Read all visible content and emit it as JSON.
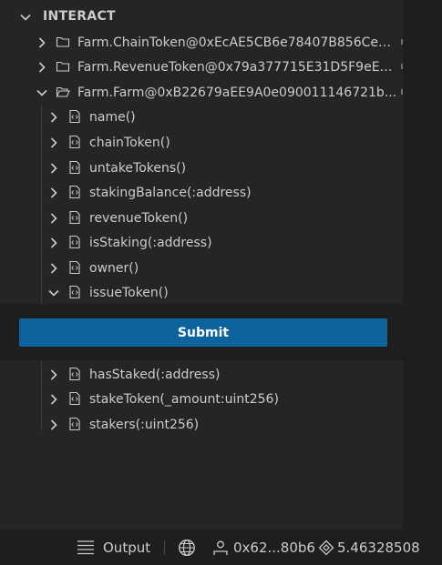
{
  "section": {
    "title": "INTERACT"
  },
  "contracts": [
    {
      "label": "Farm.ChainToken@0xEcAE5CB6e78407B856Ce2...",
      "expanded": false
    },
    {
      "label": "Farm.RevenueToken@0x79a377715E31D5F9eE7...",
      "expanded": false
    },
    {
      "label": "Farm.Farm@0xB22679aEE9A0e090011146721b...",
      "expanded": true
    }
  ],
  "functions_top": [
    {
      "label": "name()"
    },
    {
      "label": "chainToken()"
    },
    {
      "label": "untakeTokens()"
    },
    {
      "label": "stakingBalance(:address)"
    },
    {
      "label": "revenueToken()"
    },
    {
      "label": "isStaking(:address)"
    },
    {
      "label": "owner()"
    },
    {
      "label": "issueToken()",
      "expanded": true
    }
  ],
  "submit": {
    "label": "Submit"
  },
  "functions_bottom": [
    {
      "label": "hasStaked(:address)"
    },
    {
      "label": "stakeToken(_amount:uint256)"
    },
    {
      "label": "stakers(:uint256)"
    }
  ],
  "statusbar": {
    "output_label": "Output",
    "account": "0x62...80b6",
    "balance": "5.46328508"
  },
  "colors": {
    "panel_bg": "#252526",
    "editor_bg": "#1e1e1e",
    "button_bg": "#0e639c",
    "text": "#cccccc"
  }
}
